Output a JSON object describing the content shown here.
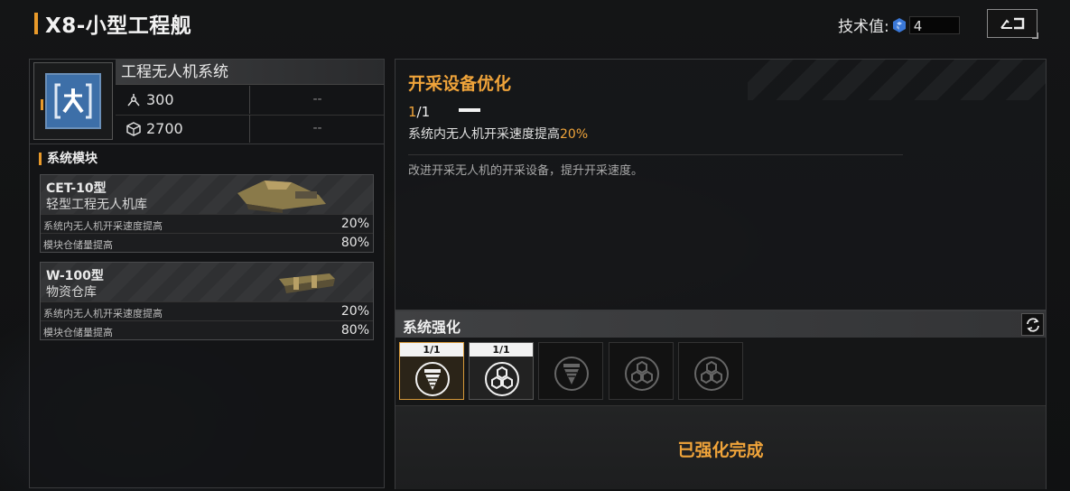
{
  "header": {
    "title": "X8-小型工程舰",
    "tech_label": "技术值:",
    "tech_value": "4"
  },
  "system": {
    "name": "工程无人机系统",
    "stats": [
      {
        "icon": "drone-icon",
        "value": "300",
        "extra": "--"
      },
      {
        "icon": "cube-icon",
        "value": "2700",
        "extra": "--"
      }
    ]
  },
  "modules": {
    "title": "系统模块",
    "items": [
      {
        "name": "CET-10型",
        "subtitle": "轻型工程无人机库",
        "rows": [
          {
            "label": "系统内无人机开采速度提高",
            "value": "20%"
          },
          {
            "label": "模块仓储量提高",
            "value": "80%"
          }
        ]
      },
      {
        "name": "W-100型",
        "subtitle": "物资仓库",
        "rows": [
          {
            "label": "系统内无人机开采速度提高",
            "value": "20%"
          },
          {
            "label": "模块仓储量提高",
            "value": "80%"
          }
        ]
      }
    ]
  },
  "upgrade": {
    "title": "开采设备优化",
    "level_current": "1",
    "level_total": "/1",
    "effect_prefix": "系统内无人机开采速度提高",
    "effect_value": "20%",
    "description": "改进开采无人机的开采设备，提升开采速度。"
  },
  "enhance": {
    "title": "系统强化",
    "slots": [
      {
        "level": "1/1",
        "icon": "drill-icon",
        "state": "selected"
      },
      {
        "level": "1/1",
        "icon": "hexagons-icon",
        "state": "owned"
      },
      {
        "level": "",
        "icon": "drill-icon",
        "state": "locked"
      },
      {
        "level": "",
        "icon": "hexagons-icon",
        "state": "locked"
      },
      {
        "level": "",
        "icon": "hexagons-icon",
        "state": "locked"
      }
    ],
    "status": "已强化完成"
  },
  "colors": {
    "accent": "#f0a43a",
    "system_icon_bg": "#3d6fa8"
  }
}
